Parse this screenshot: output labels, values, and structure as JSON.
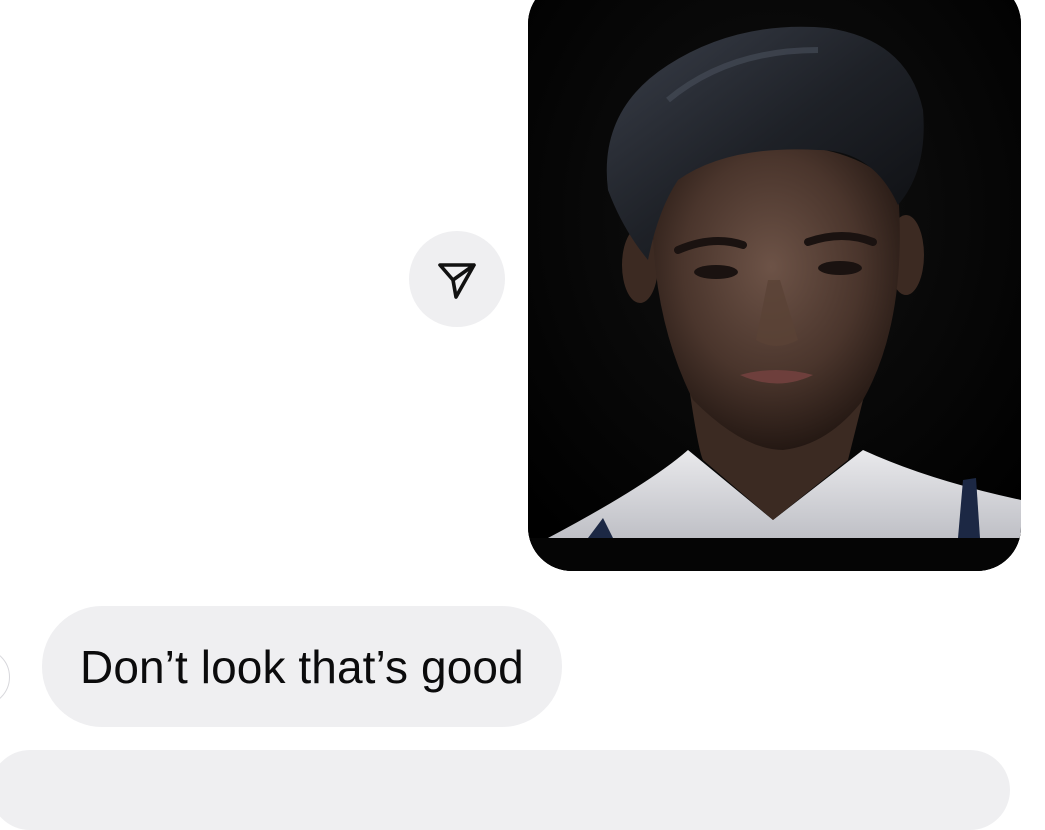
{
  "thread": {
    "shared_media": {
      "alt": "Photo of a dark-haired man in a white collared shirt with suspenders against a black background",
      "share_icon": "paper-plane-icon"
    },
    "messages": [
      {
        "text": "Don’t look that’s good"
      }
    ]
  },
  "colors": {
    "bubble_background": "#efeff1",
    "text": "#0b0b0c",
    "page_background": "#ffffff"
  }
}
